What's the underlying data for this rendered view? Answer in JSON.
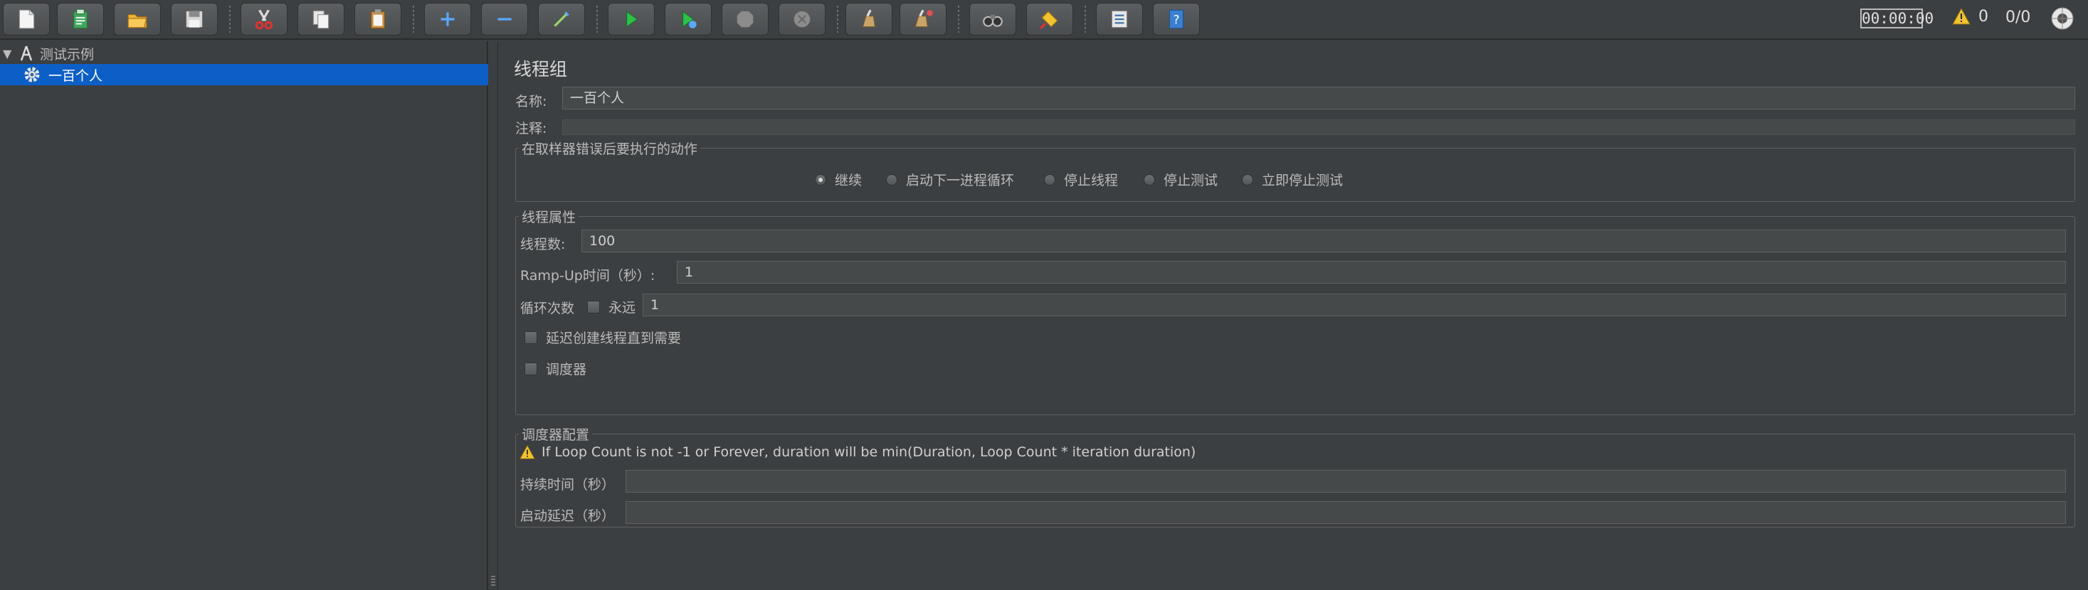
{
  "toolbar": {
    "timer": "00:00:00",
    "warning_count": "0",
    "threads": "0/0"
  },
  "tree": {
    "root_label": "测试示例",
    "child_label": "一百个人"
  },
  "panel": {
    "title": "线程组",
    "name_label": "名称:",
    "name_value": "一百个人",
    "comment_label": "注释:",
    "comment_value": "",
    "error_group_title": "在取样器错误后要执行的动作",
    "error_options": [
      {
        "label": "继续",
        "selected": true
      },
      {
        "label": "启动下一进程循环",
        "selected": false
      },
      {
        "label": "停止线程",
        "selected": false
      },
      {
        "label": "停止测试",
        "selected": false
      },
      {
        "label": "立即停止测试",
        "selected": false
      }
    ],
    "thread_group_title": "线程属性",
    "threads_label": "线程数:",
    "threads_value": "100",
    "rampup_label": "Ramp-Up时间（秒）:",
    "rampup_value": "1",
    "loop_label": "循环次数",
    "forever_label": "永远",
    "loop_value": "1",
    "delay_label": "延迟创建线程直到需要",
    "scheduler_label": "调度器",
    "scheduler_group_title": "调度器配置",
    "scheduler_warning": "If Loop Count is not -1 or Forever, duration will be min(Duration, Loop Count * iteration duration)",
    "duration_label": "持续时间（秒）",
    "duration_value": "",
    "startup_delay_label": "启动延迟（秒）",
    "startup_delay_value": ""
  }
}
